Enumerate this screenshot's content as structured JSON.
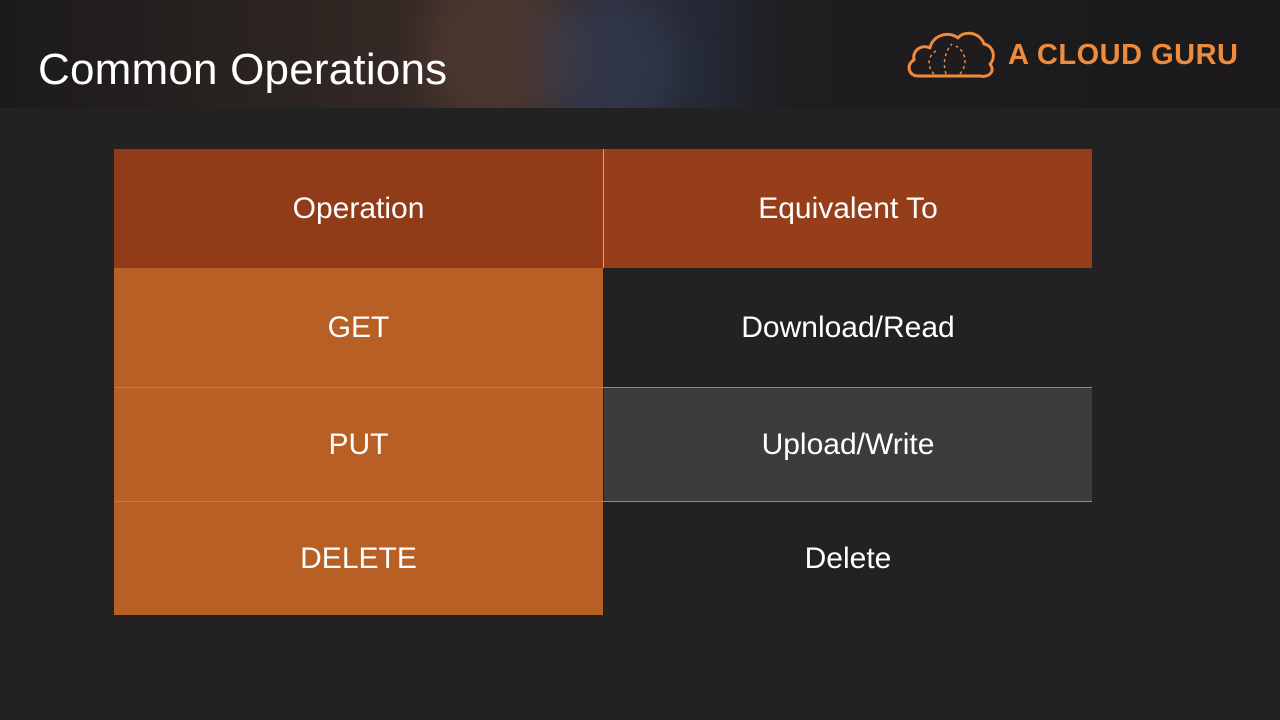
{
  "slide": {
    "title": "Common Operations"
  },
  "brand": {
    "name": "A CLOUD GURU",
    "icon": "cloud-logo-icon",
    "color": "#ee8b3c"
  },
  "table": {
    "headers": {
      "operation": "Operation",
      "equivalent": "Equivalent To"
    },
    "rows": [
      {
        "operation": "GET",
        "equivalent": "Download/Read"
      },
      {
        "operation": "PUT",
        "equivalent": "Upload/Write"
      },
      {
        "operation": "DELETE",
        "equivalent": "Delete"
      }
    ]
  },
  "colors": {
    "header_fill": "#963d19",
    "operation_fill": "#b85f25",
    "shaded_row_fill": "#3b3d3c",
    "background": "#222222"
  }
}
